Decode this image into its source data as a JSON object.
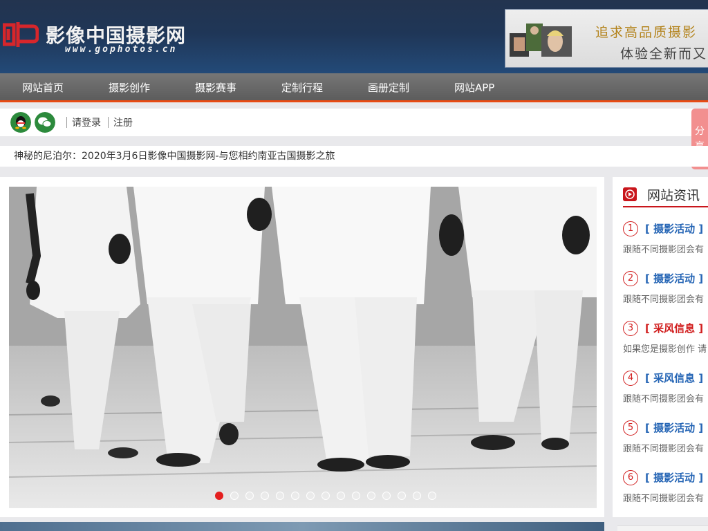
{
  "header": {
    "logo_title": "影像中国摄影网",
    "logo_url": "www.gophotos.cn",
    "banner_line1": "追求高品质摄影",
    "banner_line2": "体验全新而又"
  },
  "nav": {
    "items": [
      "网站首页",
      "摄影创作",
      "摄影赛事",
      "定制行程",
      "画册定制",
      "网站APP"
    ]
  },
  "login": {
    "login_label": "请登录",
    "register_label": "注册"
  },
  "share": {
    "label": "分享"
  },
  "notice": {
    "text": "神秘的尼泊尔：2020年3月6日影像中国摄影网-与您相约南亚古国摄影之旅"
  },
  "slideshow": {
    "dot_count": 15,
    "active_index": 0
  },
  "sidebar": {
    "title": "网站资讯",
    "items": [
      {
        "num": "1",
        "tag": "[ 摄影活动 ]",
        "desc": "跟随不同摄影团会有",
        "color": "#2565b5"
      },
      {
        "num": "2",
        "tag": "[ 摄影活动 ]",
        "desc": "跟随不同摄影团会有",
        "color": "#2565b5"
      },
      {
        "num": "3",
        "tag": "[ 采风信息 ]",
        "desc": "如果您是摄影创作 请",
        "color": "#d11e1e"
      },
      {
        "num": "4",
        "tag": "[ 采风信息 ]",
        "desc": "跟随不同摄影团会有",
        "color": "#2565b5"
      },
      {
        "num": "5",
        "tag": "[ 摄影活动 ]",
        "desc": "跟随不同摄影团会有",
        "color": "#2565b5"
      },
      {
        "num": "6",
        "tag": "[ 摄影活动 ]",
        "desc": "跟随不同摄影团会有",
        "color": "#2565b5"
      }
    ]
  },
  "colors": {
    "accent": "#e84b13",
    "header_bg": "#1f3657",
    "active_dot": "#e41f1f"
  }
}
